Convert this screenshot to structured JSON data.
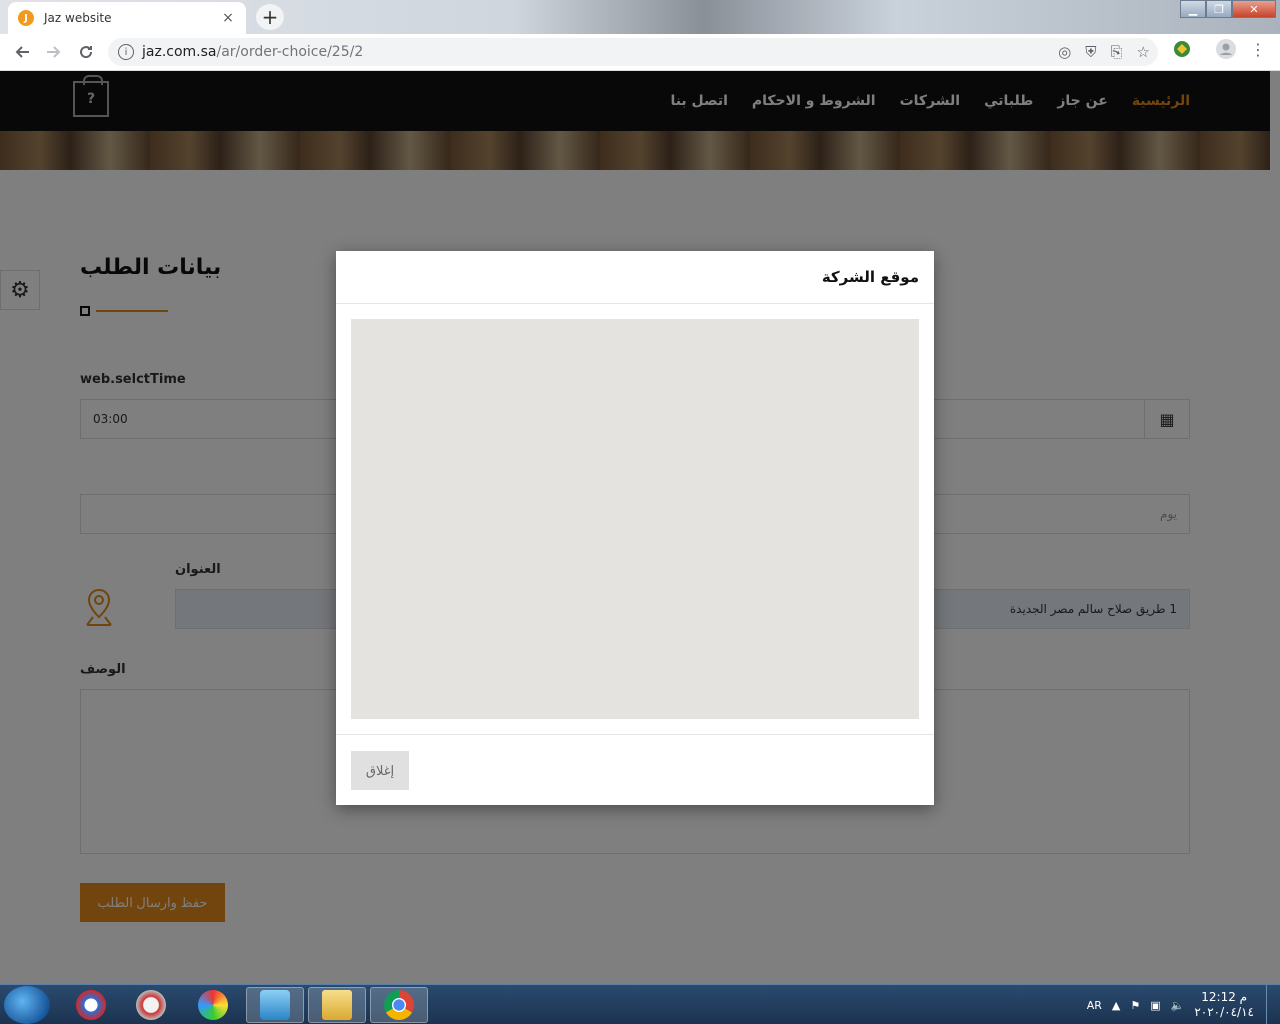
{
  "browser": {
    "tab_title": "Jaz website",
    "tab_close": "×",
    "new_tab": "+",
    "url_host": "jaz.com.sa",
    "url_path": "/ar/order-choice/25/2",
    "window": {
      "minimize": "▁",
      "maximize": "❐",
      "close": "✕"
    }
  },
  "nav": {
    "logo_mark": "?",
    "items": [
      "الرئيسية",
      "عن جاز",
      "طلباتي",
      "الشركات",
      "الشروط و الاحكام",
      "اتصل بنا"
    ],
    "active_index": 0
  },
  "form": {
    "title": "بيانات الطلب",
    "time_label": "web.selctTime",
    "time_value": "03:00",
    "day_placeholder": "يوم",
    "address_label": "العنوان",
    "address_value": "1 طريق صلاح سالم مصر الجديدة",
    "description_label": "الوصف",
    "submit_label": "حفظ وارسال الطلب"
  },
  "modal": {
    "title": "موقع الشركة",
    "close_label": "إغلاق"
  },
  "taskbar": {
    "language": "AR",
    "time": "12:12 م",
    "date": "٢٠٢٠/٠٤/١٤"
  },
  "colors": {
    "accent": "#e28b1a",
    "nav_bg": "#111111",
    "map_bg": "#e5e3df"
  }
}
